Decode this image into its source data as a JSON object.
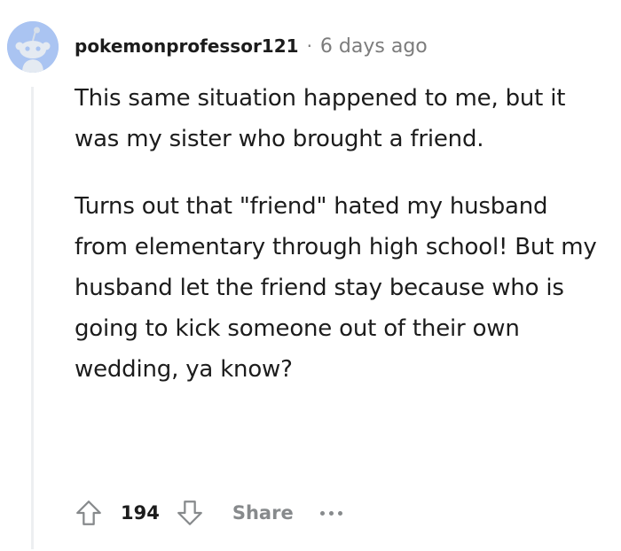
{
  "comment": {
    "username": "pokemonprofessor121",
    "separator": "·",
    "timestamp": "6 days ago",
    "paragraphs": [
      "This same situation happened to me, but it was my sister who brought a friend.",
      "Turns out that \"friend\" hated my husband from elementary through high school! But my husband let the friend stay because who is going to kick someone out of their own wedding, ya know?"
    ],
    "score": "194",
    "share_label": "Share",
    "avatar": {
      "icon": "snoo-avatar-icon",
      "background": "#aac4f2"
    }
  },
  "icons": {
    "upvote": "arrow-up-outline-icon",
    "downvote": "arrow-down-outline-icon",
    "more": "ellipsis-icon"
  },
  "colors": {
    "text": "#1c1c1c",
    "muted": "#7c7c7c",
    "action": "#878a8c",
    "thread_line": "#edeff1"
  }
}
